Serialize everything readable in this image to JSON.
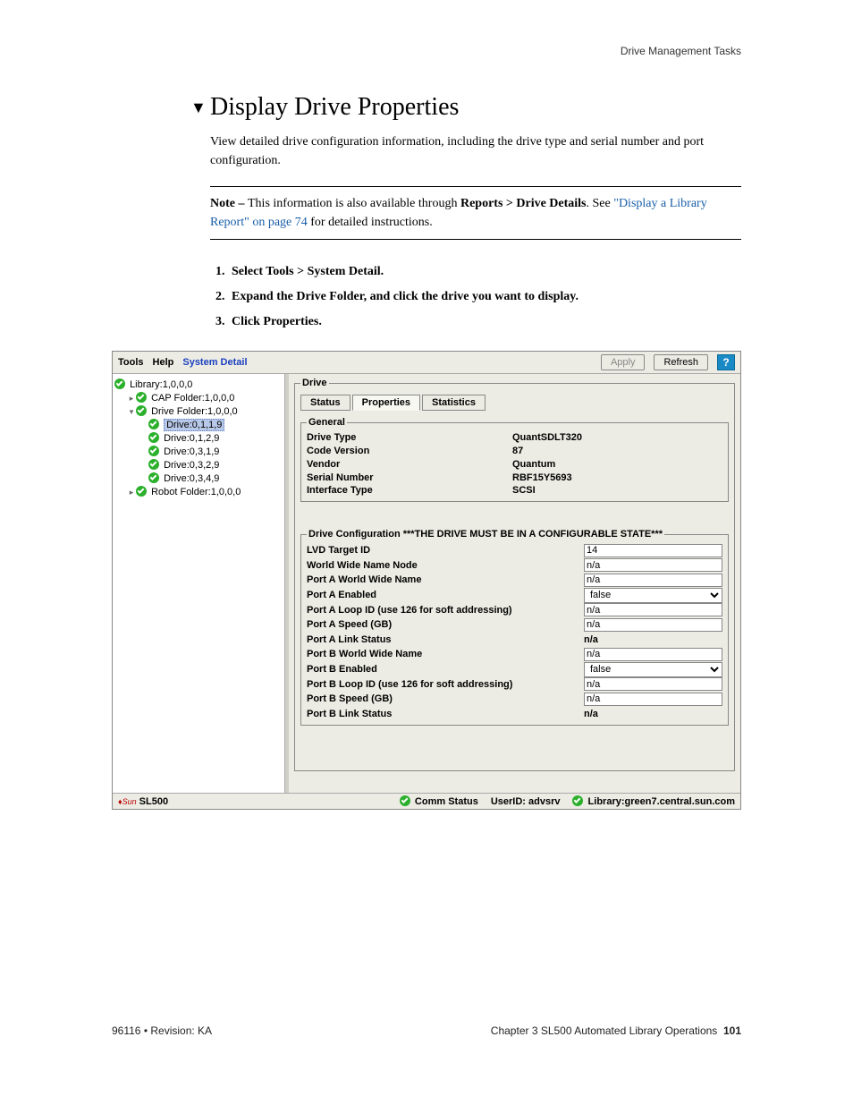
{
  "header": {
    "right": "Drive Management Tasks"
  },
  "title": "Display Drive Properties",
  "intro": "View detailed drive configuration information, including the drive type and serial number and port configuration.",
  "note": {
    "lead": "Note – ",
    "text1": "This information is also available through ",
    "bold1": "Reports > Drive Details",
    "text2": ". See ",
    "link": "\"Display a Library Report\" on page 74",
    "text3": " for detailed instructions."
  },
  "steps": [
    "Select Tools > System Detail.",
    "Expand the Drive Folder, and click the drive you want to display.",
    "Click Properties."
  ],
  "toolbar": {
    "menu": [
      "Tools",
      "Help",
      "System Detail"
    ],
    "apply": "Apply",
    "refresh": "Refresh"
  },
  "tree": [
    {
      "lvl": 1,
      "label": "Library:1,0,0,0",
      "handle": ""
    },
    {
      "lvl": 2,
      "label": "CAP Folder:1,0,0,0",
      "handle": "⊸"
    },
    {
      "lvl": 2,
      "label": "Drive Folder:1,0,0,0",
      "handle": "⊷"
    },
    {
      "lvl": 3,
      "label": "Drive:0,1,1,9",
      "sel": true
    },
    {
      "lvl": 3,
      "label": "Drive:0,1,2,9"
    },
    {
      "lvl": 3,
      "label": "Drive:0,3,1,9"
    },
    {
      "lvl": 3,
      "label": "Drive:0,3,2,9"
    },
    {
      "lvl": 3,
      "label": "Drive:0,3,4,9"
    },
    {
      "lvl": 2,
      "label": "Robot Folder:1,0,0,0",
      "handle": "⊸"
    }
  ],
  "panel": {
    "legend": "Drive",
    "tabs": [
      "Status",
      "Properties",
      "Statistics"
    ],
    "active_tab": 1,
    "general_legend": "General",
    "general": [
      {
        "k": "Drive Type",
        "v": "QuantSDLT320"
      },
      {
        "k": "Code Version",
        "v": "87"
      },
      {
        "k": "Vendor",
        "v": "Quantum"
      },
      {
        "k": "Serial Number",
        "v": "RBF15Y5693"
      },
      {
        "k": "Interface Type",
        "v": "SCSI"
      }
    ],
    "config_legend": "Drive Configuration    ***THE DRIVE MUST BE IN A CONFIGURABLE STATE***",
    "config": [
      {
        "k": "LVD Target ID",
        "v": "14",
        "type": "text"
      },
      {
        "k": "World Wide Name Node",
        "v": "n/a",
        "type": "text"
      },
      {
        "k": "Port A World Wide Name",
        "v": "n/a",
        "type": "text"
      },
      {
        "k": "Port A Enabled",
        "v": "false",
        "type": "select"
      },
      {
        "k": "Port A Loop ID (use 126 for soft addressing)",
        "v": "n/a",
        "type": "text"
      },
      {
        "k": "Port A Speed (GB)",
        "v": "n/a",
        "type": "text"
      },
      {
        "k": "Port A Link Status",
        "v": "n/a",
        "type": "static"
      },
      {
        "k": "Port B World Wide Name",
        "v": "n/a",
        "type": "text"
      },
      {
        "k": "Port B Enabled",
        "v": "false",
        "type": "select"
      },
      {
        "k": "Port B Loop ID (use 126 for soft addressing)",
        "v": "n/a",
        "type": "text"
      },
      {
        "k": "Port B Speed (GB)",
        "v": "n/a",
        "type": "text"
      },
      {
        "k": "Port B Link Status",
        "v": "n/a",
        "type": "static"
      }
    ]
  },
  "statusbar": {
    "product": "SL500",
    "comm": "Comm Status",
    "user": "UserID: advsrv",
    "library": "Library:green7.central.sun.com"
  },
  "footer": {
    "left": "96116 • Revision: KA",
    "right_text": "Chapter 3 SL500 Automated Library Operations",
    "page": "101"
  }
}
